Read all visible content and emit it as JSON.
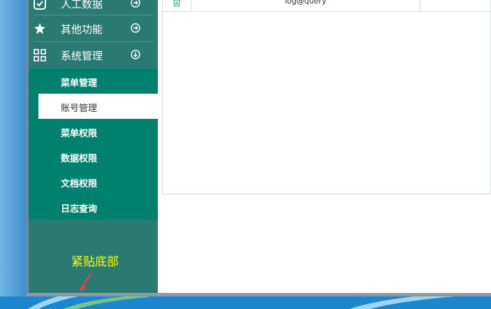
{
  "sidebar": {
    "items": [
      {
        "label": "人工数据",
        "icon": "check-box-icon"
      },
      {
        "label": "其他功能",
        "icon": "star-icon"
      },
      {
        "label": "系统管理",
        "icon": "grid-icon"
      }
    ],
    "submenu": [
      {
        "label": "菜单管理"
      },
      {
        "label": "账号管理",
        "active": true
      },
      {
        "label": "菜单权限"
      },
      {
        "label": "数据权限"
      },
      {
        "label": "文档权限"
      },
      {
        "label": "日志查询"
      }
    ]
  },
  "annotation": {
    "text": "紧贴底部"
  },
  "table": {
    "row_text": "log@query"
  },
  "colors": {
    "sidebar": "#2a7a74",
    "submenu": "#00806f",
    "active": "#ffffff",
    "annotation": "#ffff00"
  }
}
